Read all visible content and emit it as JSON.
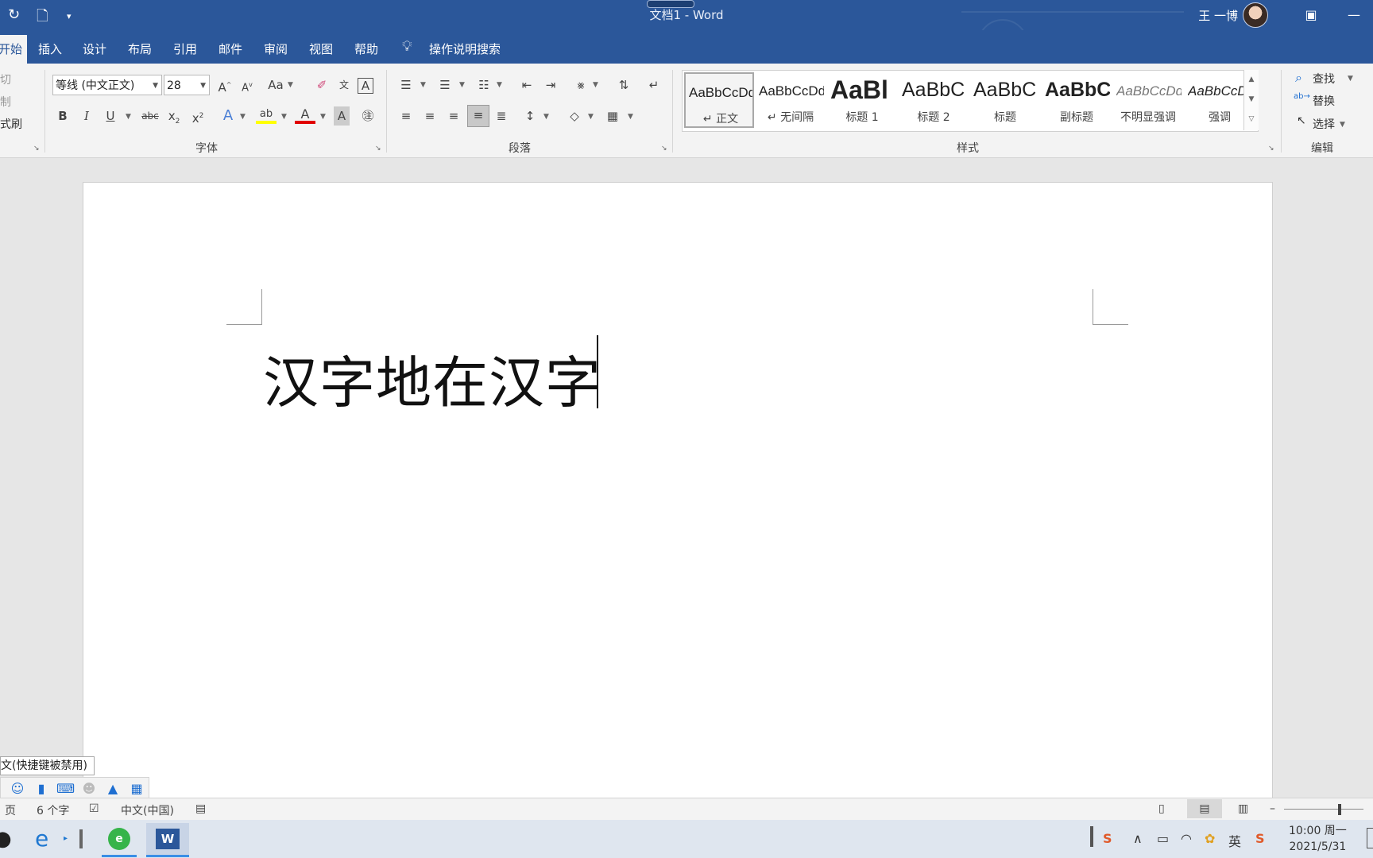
{
  "window": {
    "title": "文档1  -  Word",
    "user_name": "王 一博"
  },
  "tabs": [
    {
      "label": "开始"
    },
    {
      "label": "插入"
    },
    {
      "label": "设计"
    },
    {
      "label": "布局"
    },
    {
      "label": "引用"
    },
    {
      "label": "邮件"
    },
    {
      "label": "审阅"
    },
    {
      "label": "视图"
    },
    {
      "label": "帮助"
    }
  ],
  "tell_me": "操作说明搜索",
  "clipboard": {
    "cut": "剪切",
    "copy": "复制",
    "format_painter": "格式刷"
  },
  "font": {
    "name": "等线 (中文正文)",
    "size": "28",
    "group_label": "字体",
    "case_label": "Aa"
  },
  "paragraph": {
    "group_label": "段落"
  },
  "styles": {
    "group_label": "样式",
    "items": [
      {
        "preview": "AaBbCcDd",
        "name": "↵ 正文"
      },
      {
        "preview": "AaBbCcDd",
        "name": "↵ 无间隔"
      },
      {
        "preview": "AaBl",
        "name": "标题 1"
      },
      {
        "preview": "AaBbC",
        "name": "标题 2"
      },
      {
        "preview": "AaBbC",
        "name": "标题"
      },
      {
        "preview": "AaBbC",
        "name": "副标题"
      },
      {
        "preview": "AaBbCcDd",
        "name": "不明显强调"
      },
      {
        "preview": "AaBbCcDd",
        "name": "强调"
      }
    ]
  },
  "editing": {
    "find": "查找",
    "replace": "替换",
    "select": "选择",
    "group_label": "编辑"
  },
  "document": {
    "text": "汉字地在汉字"
  },
  "ime": {
    "tip": "文(快捷键被禁用)"
  },
  "status": {
    "page": "页",
    "word_count": "6 个字",
    "language": "中文(中国)"
  },
  "taskbar": {
    "time": "10:00 周一",
    "date": "2021/5/31",
    "ime_lang": "英"
  },
  "colors": {
    "word_blue": "#2b579a",
    "highlight_yellow": "#ffff00",
    "font_color_red": "#e00000"
  }
}
